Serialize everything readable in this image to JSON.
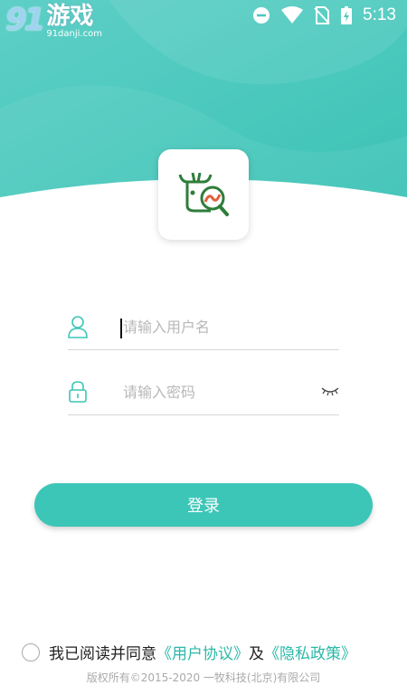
{
  "watermark": {
    "brand_num": "91",
    "brand_name": "游戏",
    "url": "91danji.com"
  },
  "status_bar": {
    "time": "5:13"
  },
  "form": {
    "username_placeholder": "请输入用户名",
    "password_placeholder": "请输入密码"
  },
  "login_button": "登录",
  "agreement": {
    "prefix": "我已阅读并同意",
    "user_agreement": "《用户协议》",
    "and": "及",
    "privacy_policy": "《隐私政策》"
  },
  "copyright": "版权所有©2015-2020  一牧科技(北京)有限公司",
  "colors": {
    "accent": "#3cc6b7",
    "link": "#2cb8a8"
  }
}
